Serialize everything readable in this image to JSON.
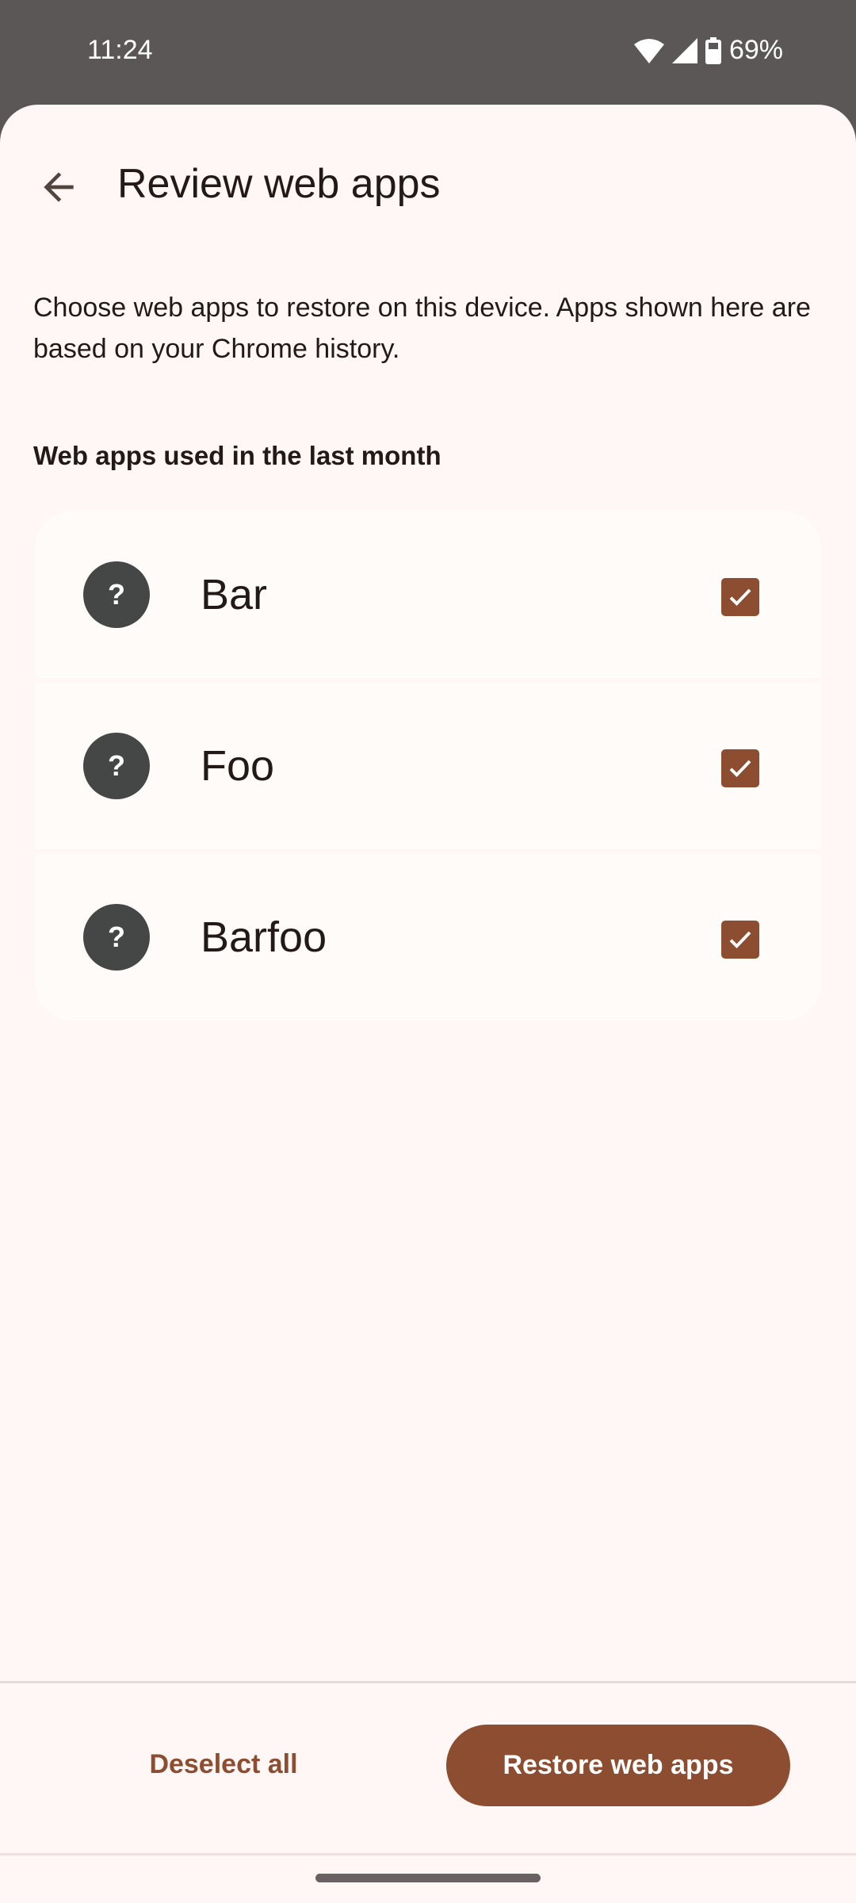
{
  "status_bar": {
    "time": "11:24",
    "battery": "69%",
    "icons": [
      "wifi-icon",
      "signal-icon",
      "battery-icon"
    ]
  },
  "header": {
    "title": "Review web apps",
    "back_icon": "arrow-back-icon"
  },
  "description": "Choose web apps to restore on this device. Apps shown here are based on your Chrome history.",
  "section_title": "Web apps used in the last month",
  "apps": [
    {
      "name": "Bar",
      "icon_glyph": "?",
      "checked": true
    },
    {
      "name": "Foo",
      "icon_glyph": "?",
      "checked": true
    },
    {
      "name": "Barfoo",
      "icon_glyph": "?",
      "checked": true
    }
  ],
  "actions": {
    "deselect_label": "Deselect all",
    "restore_label": "Restore web apps"
  },
  "colors": {
    "accent": "#8d4d31",
    "background": "#fff7f5",
    "status_bar": "#5a5756",
    "app_icon": "#444746"
  }
}
